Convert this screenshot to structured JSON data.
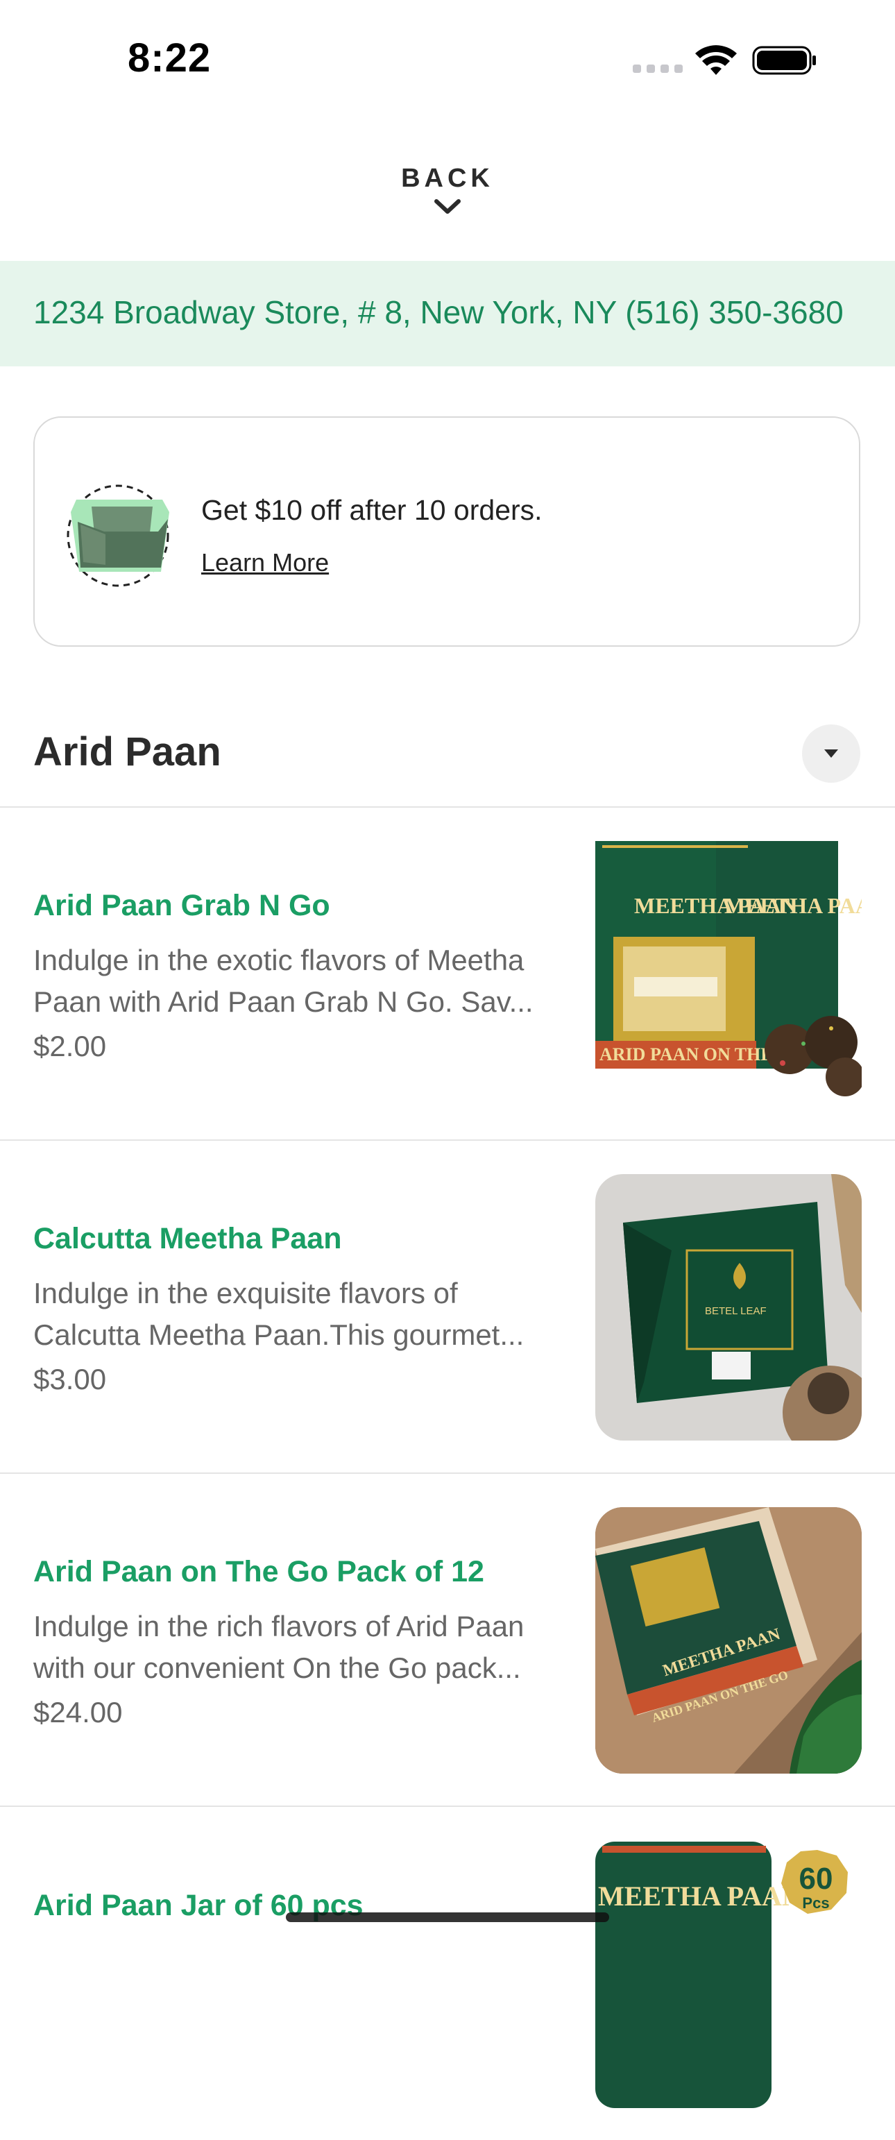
{
  "status_bar": {
    "time": "8:22"
  },
  "nav": {
    "back_label": "BACK"
  },
  "store": {
    "address": "1234 Broadway Store, # 8, New York, NY (516) 350-3680"
  },
  "promo": {
    "title": "Get $10 off after 10 orders.",
    "link": "Learn More"
  },
  "section": {
    "title": "Arid Paan"
  },
  "items": [
    {
      "name": "Arid Paan Grab N Go",
      "desc_line1": "Indulge in the exotic flavors of Meetha",
      "desc_line2": "Paan with Arid Paan Grab N Go. Sav...",
      "price": "$2.00",
      "image_text": "MEETHA PAAN",
      "image_band": "ARID PAAN ON THE GO"
    },
    {
      "name": "Calcutta Meetha Paan",
      "desc_line1": "Indulge in the exquisite flavors of",
      "desc_line2": "Calcutta Meetha Paan.This gourmet...",
      "price": "$3.00",
      "image_text": "BETEL LEAF"
    },
    {
      "name": "Arid Paan on The Go Pack of 12",
      "desc_line1": "Indulge in the rich flavors of Arid Paan",
      "desc_line2": "with our convenient On the Go pack...",
      "price": "$24.00",
      "image_text": "MEETHA PAAN",
      "image_band": "ARID PAAN ON THE GO"
    },
    {
      "name": "Arid Paan Jar of 60 pcs",
      "image_text": "MEETHA PAAN",
      "badge_num": "60",
      "badge_unit": "Pcs"
    }
  ],
  "colors": {
    "accent": "#1a9e64",
    "address_bg": "#e6f5ec",
    "address_text": "#1a8a5b",
    "pack_green": "#17543a",
    "gold": "#d9b44a"
  }
}
